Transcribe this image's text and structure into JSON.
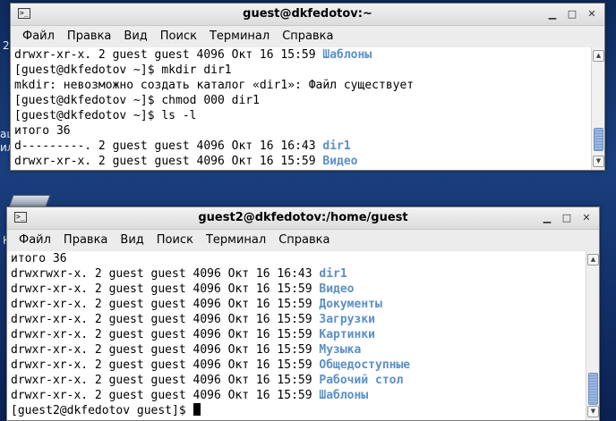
{
  "desktop_fragments": [
    "2",
    "ац",
    "ил",
    "К"
  ],
  "window1": {
    "title": "guest@dkfedotov:~",
    "menu": [
      "Файл",
      "Правка",
      "Вид",
      "Поиск",
      "Терминал",
      "Справка"
    ],
    "lines": [
      {
        "text": "drwxr-xr-x. 2 guest guest 4096 Окт 16 15:59 ",
        "name": "Шаблоны"
      },
      {
        "text": "[guest@dkfedotov ~]$ mkdir dir1"
      },
      {
        "text": "mkdir: невозможно создать каталог «dir1»: Файл существует"
      },
      {
        "text": "[guest@dkfedotov ~]$ chmod 000 dir1"
      },
      {
        "text": "[guest@dkfedotov ~]$ ls -l"
      },
      {
        "text": "итого 36"
      },
      {
        "text": "d---------. 2 guest guest 4096 Окт 16 16:43 ",
        "name": "dir1"
      },
      {
        "text": "drwxr-xr-x. 2 guest guest 4096 Окт 16 15:59 ",
        "name": "Видео"
      }
    ]
  },
  "window2": {
    "title": "guest2@dkfedotov:/home/guest",
    "menu": [
      "Файл",
      "Правка",
      "Вид",
      "Поиск",
      "Терминал",
      "Справка"
    ],
    "lines": [
      {
        "text": "итого 36"
      },
      {
        "text": "drwxrwxr-x. 2 guest guest 4096 Окт 16 16:43 ",
        "name": "dir1"
      },
      {
        "text": "drwxr-xr-x. 2 guest guest 4096 Окт 16 15:59 ",
        "name": "Видео"
      },
      {
        "text": "drwxr-xr-x. 2 guest guest 4096 Окт 16 15:59 ",
        "name": "Документы"
      },
      {
        "text": "drwxr-xr-x. 2 guest guest 4096 Окт 16 15:59 ",
        "name": "Загрузки"
      },
      {
        "text": "drwxr-xr-x. 2 guest guest 4096 Окт 16 15:59 ",
        "name": "Картинки"
      },
      {
        "text": "drwxr-xr-x. 2 guest guest 4096 Окт 16 15:59 ",
        "name": "Музыка"
      },
      {
        "text": "drwxr-xr-x. 2 guest guest 4096 Окт 16 15:59 ",
        "name": "Общедоступные"
      },
      {
        "text": "drwxr-xr-x. 2 guest guest 4096 Окт 16 15:59 ",
        "name": "Рабочий стол"
      },
      {
        "text": "drwxr-xr-x. 2 guest guest 4096 Окт 16 15:59 ",
        "name": "Шаблоны"
      }
    ],
    "prompt": "[guest2@dkfedotov guest]$ "
  },
  "colors": {
    "directory": "#5b8fc7",
    "scroll_thumb": "#8aaadc"
  },
  "icons": {
    "window": "terminal-icon",
    "minimize": "minimize-icon",
    "maximize": "maximize-icon",
    "close": "close-icon"
  }
}
